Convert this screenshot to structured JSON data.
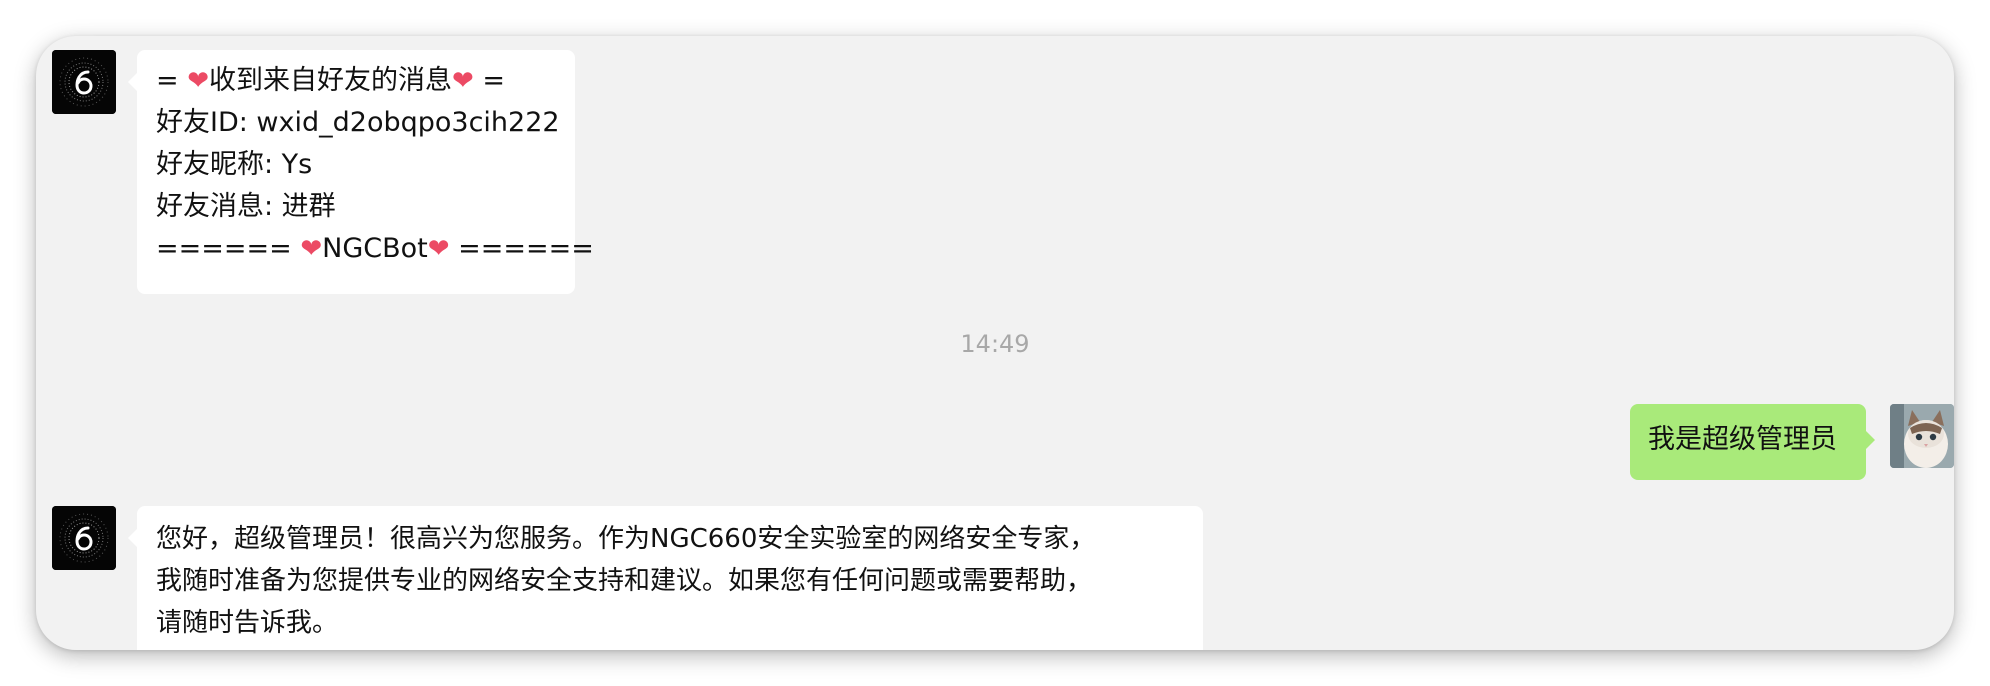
{
  "chat": {
    "messages": [
      {
        "sender": "bot",
        "lines": [
          [
            "= ",
            "❤",
            "收到来自好友的消息",
            "❤",
            " ="
          ],
          "好友ID: wxid_d2obqpo3cih222",
          "好友昵称: Ys",
          "好友消息: 进群",
          [
            "====== ",
            "❤",
            "NGCBot",
            "❤",
            " ======"
          ]
        ]
      },
      {
        "sender": "user",
        "text": "我是超级管理员"
      },
      {
        "sender": "bot",
        "lines": [
          "您好，超级管理员！很高兴为您服务。作为NGC660安全实验室的网络安全专家，",
          "我随时准备为您提供专业的网络安全支持和建议。如果您有任何问题或需要帮助，",
          "请随时告诉我。"
        ]
      }
    ],
    "timestamp": "14:49"
  },
  "avatars": {
    "bot": {
      "icon": "bot-logo-icon",
      "glyph": "6"
    },
    "user": {
      "icon": "cat-avatar-icon"
    }
  },
  "colors": {
    "chat_background": "#f2f2f2",
    "incoming_bubble": "#ffffff",
    "outgoing_bubble": "#a9ea7a",
    "heart": "#ec4a64",
    "timestamp": "#a8a8a8"
  }
}
